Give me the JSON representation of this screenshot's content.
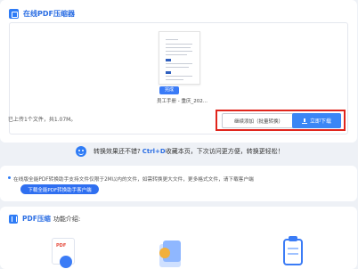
{
  "header": {
    "title": "在线PDF压缩器"
  },
  "file": {
    "badge": "完成",
    "name": "员工手册 - 重庆_202..."
  },
  "status": {
    "text": "已上传1个文件，共1.07M。"
  },
  "actions": {
    "continue_add": "继续添加（批量转换）",
    "download": "立即下载"
  },
  "feedback": {
    "prefix": "转换效果还不错?",
    "shortcut": "Ctrl+D",
    "suffix": "收藏本页，下次访问更方便，转换更轻松！"
  },
  "notice": {
    "text": "在线版全能PDF转换助手支持文件仅限于2M以内的文件，如需转换更大文件，更多格式文件，请下载客户端",
    "button": "下载全能PDF转换助手客户端"
  },
  "intro": {
    "title": "PDF压缩",
    "subtitle": "功能介绍:",
    "feature1_label": "PDF"
  },
  "colors": {
    "accent": "#2f7cf6",
    "highlight_border": "#e0251c"
  }
}
